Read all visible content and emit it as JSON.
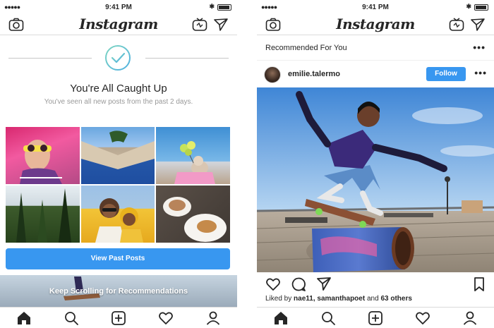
{
  "status": {
    "time": "9:41 PM"
  },
  "app": {
    "name": "Instagram"
  },
  "left": {
    "caught_up_title": "You're All Caught Up",
    "caught_up_sub": "You've seen all new posts from the past 2 days.",
    "view_past_label": "View Past Posts",
    "keep_scrolling_label": "Keep Scrolling for Recommendations"
  },
  "right": {
    "recommended_label": "Recommended For You",
    "post": {
      "username": "emilie.talermo",
      "follow_label": "Follow",
      "liked_by_prefix": "Liked by",
      "liked_by_users": "nae11, samanthapoet",
      "liked_by_and": "and",
      "liked_by_others": "63 others"
    }
  },
  "icons": {
    "camera": "camera-icon",
    "igtv": "igtv-icon",
    "direct": "send-icon",
    "home": "home-icon",
    "search": "search-icon",
    "new_post": "add-post-icon",
    "activity": "heart-icon",
    "profile": "profile-icon"
  },
  "colors": {
    "accent": "#3897f0",
    "check": "#36c6a1",
    "text": "#262626"
  }
}
